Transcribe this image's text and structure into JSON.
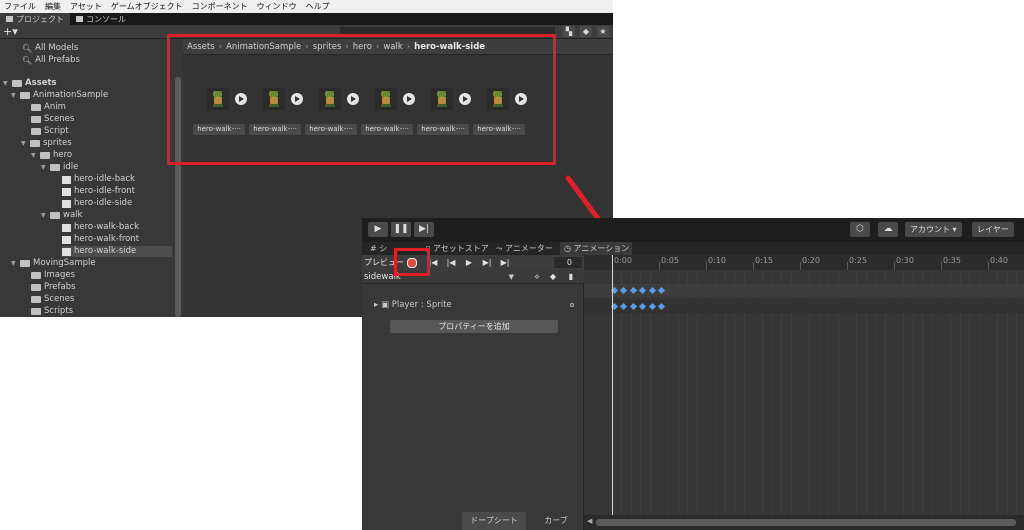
{
  "menu": [
    "ファイル",
    "編集",
    "アセット",
    "ゲームオブジェクト",
    "コンポーネント",
    "ウィンドウ",
    "ヘルプ"
  ],
  "project_tabs": {
    "project": "プロジェクト",
    "console": "コンソール"
  },
  "project_toolbar": {
    "plus": "+▾"
  },
  "tree": {
    "all_models": "All Models",
    "all_prefabs": "All Prefabs",
    "assets": "Assets",
    "animation_sample": "AnimationSample",
    "anim": "Anim",
    "scenes": "Scenes",
    "script": "Script",
    "sprites": "sprites",
    "hero": "hero",
    "idle": "idle",
    "hero_idle_back": "hero-idle-back",
    "hero_idle_front": "hero-idle-front",
    "hero_idle_side": "hero-idle-side",
    "walk": "walk",
    "hero_walk_back": "hero-walk-back",
    "hero_walk_front": "hero-walk-front",
    "hero_walk_side": "hero-walk-side",
    "moving_sample": "MovingSample",
    "images": "Images",
    "prefabs": "Prefabs",
    "ms_scenes": "Scenes",
    "scripts": "Scripts"
  },
  "breadcrumb": [
    "Assets",
    "AnimationSample",
    "sprites",
    "hero",
    "walk",
    "hero-walk-side"
  ],
  "assets": [
    {
      "label": "hero-walk-···"
    },
    {
      "label": "hero-walk-···"
    },
    {
      "label": "hero-walk-···"
    },
    {
      "label": "hero-walk-···"
    },
    {
      "label": "hero-walk-···"
    },
    {
      "label": "hero-walk-···"
    }
  ],
  "anim_toolbar": {
    "account": "アカウント",
    "layers": "レイヤー"
  },
  "anim_tabs": {
    "scene": "シ",
    "asset_store": "アセットストア",
    "animator": "アニメーター",
    "animation": "アニメーション"
  },
  "anim_controls": {
    "preview": "プレビュー",
    "frame": "0",
    "clip": "sidewalk",
    "property": "Player : Sprite",
    "add_property": "プロパティーを追加",
    "dopesheet": "ドープシート",
    "curves": "カーブ"
  },
  "ruler_ticks": [
    "0:00",
    "0:05",
    "0:10",
    "0:15",
    "0:20",
    "0:25",
    "0:30",
    "0:35",
    "0:40"
  ],
  "keyframes_count": 6,
  "colors": {
    "highlight": "#e11e28",
    "keyframe": "#5a9de6",
    "record": "#e4493c"
  }
}
